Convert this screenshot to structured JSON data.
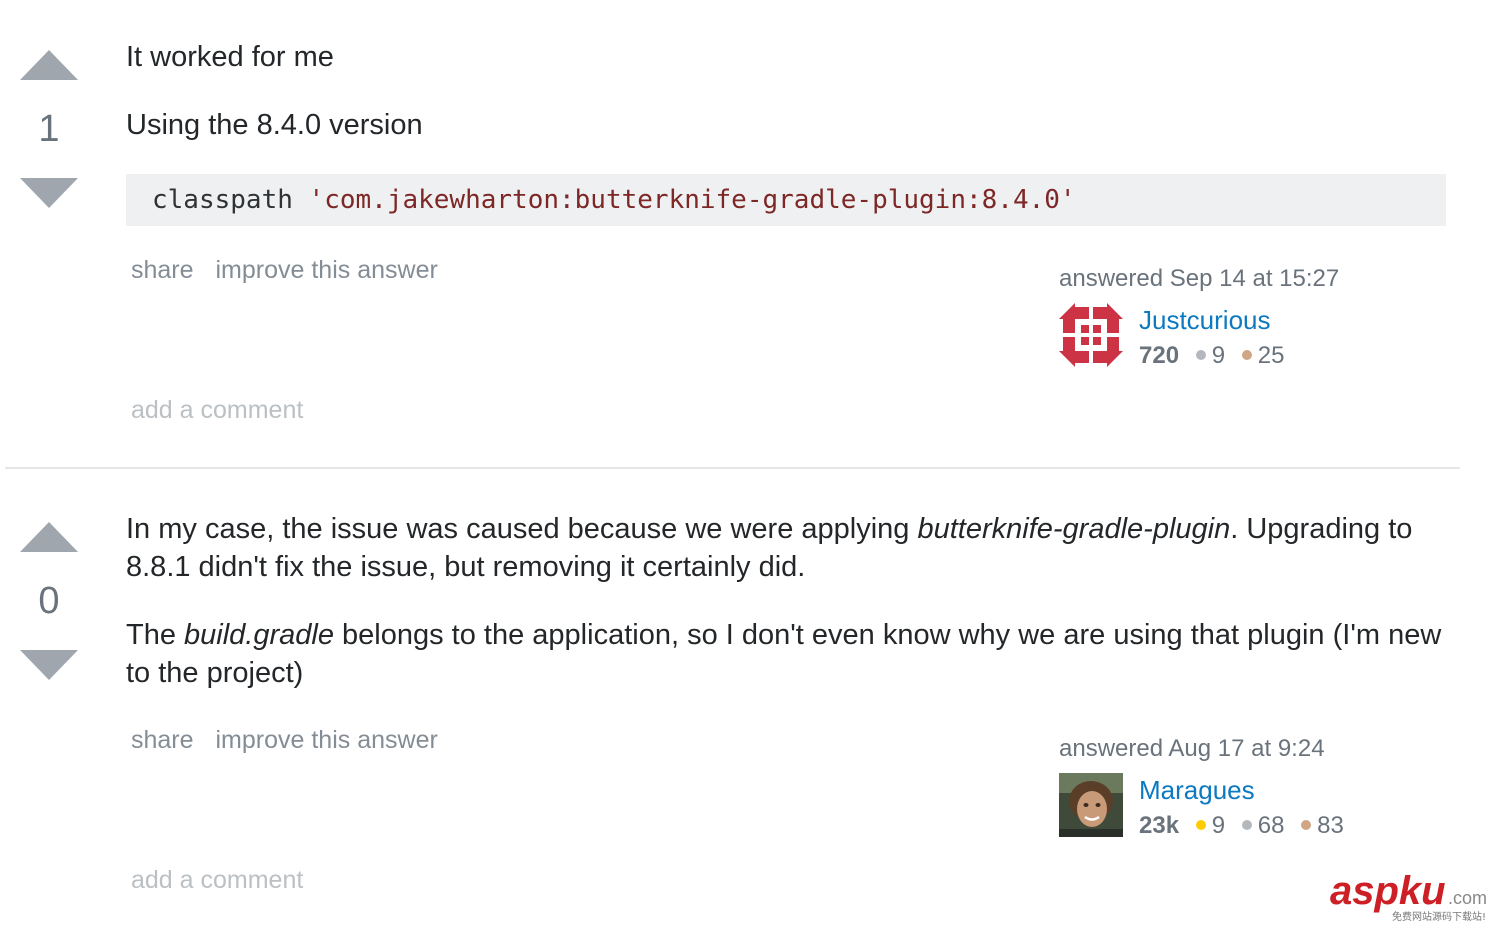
{
  "answers": [
    {
      "votes": "1",
      "paragraphs": [
        "It worked for me",
        "Using the 8.4.0 version"
      ],
      "code": {
        "keyword": "classpath",
        "string": "'com.jakewharton:butterknife-gradle-plugin:8.4.0'"
      },
      "menu": {
        "share": "share",
        "improve": "improve this answer"
      },
      "answered": "answered Sep 14 at 15:27",
      "user": {
        "name": "Justcurious",
        "reputation": "720",
        "silver": "9",
        "bronze": "25"
      },
      "add_comment": "add a comment"
    },
    {
      "votes": "0",
      "p1": {
        "before": "In my case, the issue was caused because we were applying ",
        "em": "butterknife-gradle-plugin",
        "after": ". Upgrading to 8.8.1 didn't fix the issue, but removing it certainly did."
      },
      "p2": {
        "before": "The ",
        "em": "build.gradle",
        "after": " belongs to the application, so I don't even know why we are using that plugin (I'm new to the project)"
      },
      "menu": {
        "share": "share",
        "improve": "improve this answer"
      },
      "answered": "answered Aug 17 at 9:24",
      "user": {
        "name": "Maragues",
        "reputation": "23k",
        "gold": "9",
        "silver": "68",
        "bronze": "83"
      },
      "add_comment": "add a comment"
    }
  ],
  "colors": {
    "gold": "#ffcc01",
    "silver": "#b4b8bc",
    "bronze": "#d1a684",
    "link": "#0c79c1",
    "identicon": "#cc3344"
  },
  "watermark": {
    "main": "aspku",
    "suffix": ".com",
    "tagline": "免费网站源码下载站!"
  }
}
